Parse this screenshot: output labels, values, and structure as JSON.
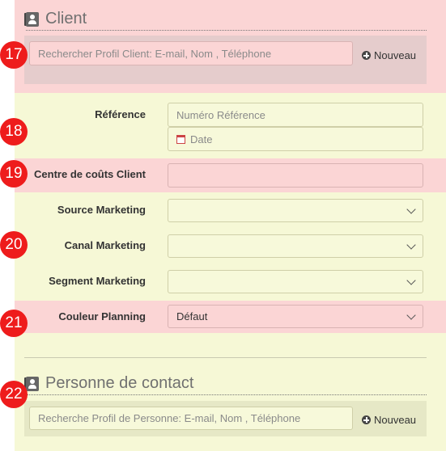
{
  "client": {
    "title": "Client",
    "badge": "17",
    "search_placeholder": "Rechercher Profil Client: E-mail, Nom , Téléphone",
    "new_label": "Nouveau"
  },
  "reference": {
    "badge": "18",
    "label": "Référence",
    "number_placeholder": "Numéro Référence",
    "date_placeholder": "Date"
  },
  "cost_center": {
    "badge": "19",
    "label": "Centre de coûts Client",
    "value": ""
  },
  "marketing": {
    "badge": "20",
    "source_label": "Source Marketing",
    "source_value": "",
    "channel_label": "Canal Marketing",
    "channel_value": "",
    "segment_label": "Segment Marketing",
    "segment_value": ""
  },
  "planning": {
    "badge": "21",
    "label": "Couleur Planning",
    "value": "Défaut"
  },
  "contact": {
    "title": "Personne de contact",
    "badge": "22",
    "search_placeholder": "Recherche Profil de Personne: E-mail, Nom , Téléphone",
    "new_label": "Nouveau"
  },
  "colors": {
    "badge": "#ee1c1c",
    "pink_zone": "#fbd5d5",
    "yellow_zone": "#f6f8d6"
  }
}
